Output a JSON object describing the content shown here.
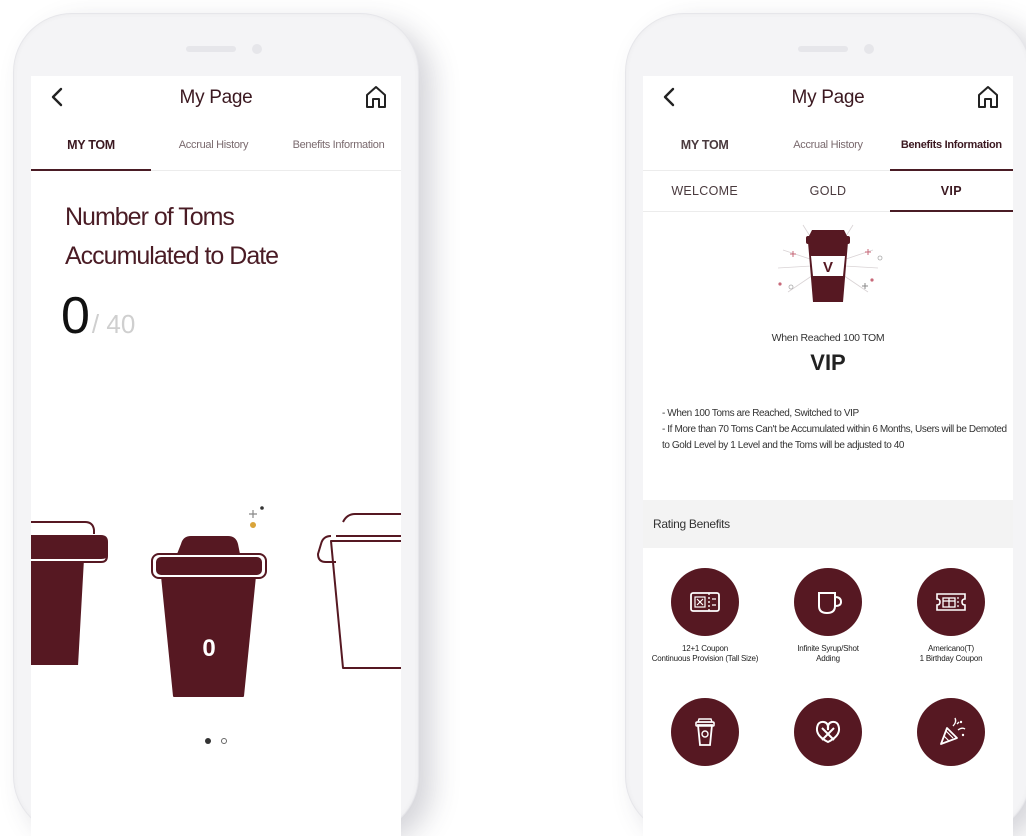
{
  "left_screen": {
    "title": "My Page",
    "tabs": [
      "MY TOM",
      "Accrual History",
      "Benefits Information"
    ],
    "active_tab": "MY TOM",
    "headline_line1": "Number of Toms",
    "headline_line2": "Accumulated to Date",
    "count_current": "0",
    "count_total": "/ 40",
    "cup_number": "0",
    "pagination": {
      "pages": 2,
      "current": 1
    }
  },
  "right_screen": {
    "title": "My Page",
    "tabs": [
      "MY TOM",
      "Accrual History",
      "Benefits Information"
    ],
    "active_tab": "Benefits Information",
    "level_tabs": [
      "WELCOME",
      "GOLD",
      "VIP"
    ],
    "active_level": "VIP",
    "badge_letter": "V",
    "reached_text": "When Reached 100 TOM",
    "level_name": "VIP",
    "rules": [
      "- When 100 Toms are Reached, Switched to VIP",
      "- If More than 70 Toms Can't be Accumulated within 6 Months, Users will be Demoted to Gold Level by 1 Level and the Toms will be adjusted to 40"
    ],
    "rating_benefits_title": "Rating Benefits",
    "benefits": [
      {
        "label": "12+1 Coupon\nContinuous Provision (Tall Size)",
        "icon": "coupon-icon"
      },
      {
        "label": "Infinite Syrup/Shot\nAdding",
        "icon": "mug-icon"
      },
      {
        "label": "Americano(T)\n1 Birthday Coupon",
        "icon": "gift-ticket-icon"
      },
      {
        "label": "",
        "icon": "coffee-cup-icon"
      },
      {
        "label": "",
        "icon": "pretzel-icon"
      },
      {
        "label": "",
        "icon": "party-popper-icon"
      }
    ]
  },
  "colors": {
    "brand": "#561822",
    "text_dark": "#3b1820",
    "accent_gold": "#d9a43a"
  }
}
